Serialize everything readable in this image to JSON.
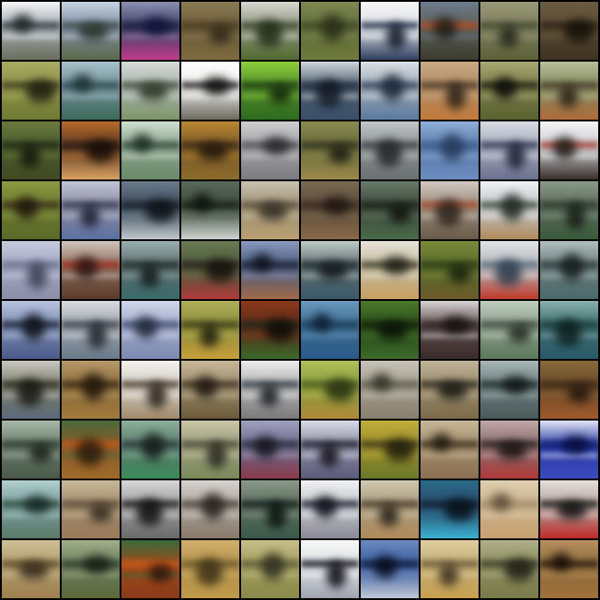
{
  "grid": {
    "rows": 10,
    "columns": 10,
    "tiles": [
      {
        "row": 0,
        "col": 0,
        "bg": "#9fa7ad",
        "top": "#f4f6f7",
        "mid": "#2f3a3e",
        "low": "#6b6f5e",
        "blob": "#1b2022"
      },
      {
        "row": 0,
        "col": 1,
        "bg": "#7d8aa0",
        "top": "#c7d4e3",
        "mid": "#3b4a44",
        "low": "#5d6a4a",
        "blob": "#263026"
      },
      {
        "row": 0,
        "col": 2,
        "bg": "#3a3f63",
        "top": "#8d8fb2",
        "mid": "#1a1c3a",
        "low": "#c23b8a",
        "blob": "#10123a"
      },
      {
        "row": 0,
        "col": 3,
        "bg": "#6b5a38",
        "top": "#8a7b55",
        "mid": "#4a3c22",
        "low": "#7d6a3f",
        "blob": "#2d2516"
      },
      {
        "row": 0,
        "col": 4,
        "bg": "#8c8f7a",
        "top": "#d8dad3",
        "mid": "#3c4a2c",
        "low": "#4f6b2f",
        "blob": "#1c2a12"
      },
      {
        "row": 0,
        "col": 5,
        "bg": "#5f6b3a",
        "top": "#7f8a52",
        "mid": "#3d4a25",
        "low": "#6d7a3a",
        "blob": "#2a2f16"
      },
      {
        "row": 0,
        "col": 6,
        "bg": "#d9dde2",
        "top": "#f7f7f7",
        "mid": "#1c2a45",
        "low": "#2f3f5f",
        "blob": "#0d1526"
      },
      {
        "row": 0,
        "col": 7,
        "bg": "#5c5f58",
        "top": "#6d7b8c",
        "mid": "#b44a1f",
        "low": "#3c3b2f",
        "blob": "#1f1c15"
      },
      {
        "row": 0,
        "col": 8,
        "bg": "#7d7c5d",
        "top": "#9a9a78",
        "mid": "#3f4a2c",
        "low": "#5c6238",
        "blob": "#22261a"
      },
      {
        "row": 0,
        "col": 9,
        "bg": "#5a4a30",
        "top": "#6a5c42",
        "mid": "#2a2118",
        "low": "#3d3222",
        "blob": "#120e08"
      },
      {
        "row": 1,
        "col": 0,
        "bg": "#8d9146",
        "top": "#a8ab63",
        "mid": "#3b3a1f",
        "low": "#6e7a33",
        "blob": "#1c1a0f"
      },
      {
        "row": 1,
        "col": 1,
        "bg": "#6f8b93",
        "top": "#a7c4cc",
        "mid": "#2a4a4f",
        "low": "#3c6a5a",
        "blob": "#1a2f2f"
      },
      {
        "row": 1,
        "col": 2,
        "bg": "#a6b0aa",
        "top": "#d6dcd8",
        "mid": "#3f4f3a",
        "low": "#7d9668",
        "blob": "#2a3322"
      },
      {
        "row": 1,
        "col": 3,
        "bg": "#e7e8e6",
        "top": "#ffffff",
        "mid": "#1a1a1a",
        "low": "#6d6a5d",
        "blob": "#0c0c0c"
      },
      {
        "row": 1,
        "col": 4,
        "bg": "#4f8a2a",
        "top": "#8dcf3a",
        "mid": "#1c3a12",
        "low": "#2f6b1f",
        "blob": "#0f2008"
      },
      {
        "row": 1,
        "col": 5,
        "bg": "#4a5a6a",
        "top": "#cfd7de",
        "mid": "#1f2a3a",
        "low": "#3a4f6a",
        "blob": "#0f1520"
      },
      {
        "row": 1,
        "col": 6,
        "bg": "#9aa5b0",
        "top": "#dbe2e8",
        "mid": "#2f3f5c",
        "low": "#5a7aa0",
        "blob": "#1a2538"
      },
      {
        "row": 1,
        "col": 7,
        "bg": "#b08a62",
        "top": "#c9ab86",
        "mid": "#4a3a2a",
        "low": "#c27a3a",
        "blob": "#2a1f15"
      },
      {
        "row": 1,
        "col": 8,
        "bg": "#7a7a4a",
        "top": "#a8a872",
        "mid": "#1c1f12",
        "low": "#5a6230",
        "blob": "#0c0d08"
      },
      {
        "row": 1,
        "col": 9,
        "bg": "#7f8a5f",
        "top": "#b7bf98",
        "mid": "#4a3a2a",
        "low": "#b06a3a",
        "blob": "#2a1f15"
      },
      {
        "row": 2,
        "col": 0,
        "bg": "#4a5a2a",
        "top": "#6b7a3f",
        "mid": "#1f2616",
        "low": "#3f4a22",
        "blob": "#10140a"
      },
      {
        "row": 2,
        "col": 1,
        "bg": "#5a3a22",
        "top": "#b86a2a",
        "mid": "#2a1a12",
        "low": "#d9a060",
        "blob": "#140c08"
      },
      {
        "row": 2,
        "col": 2,
        "bg": "#8aa08a",
        "top": "#cfe0d0",
        "mid": "#2f4a3a",
        "low": "#6a8a6a",
        "blob": "#1a2a20"
      },
      {
        "row": 2,
        "col": 3,
        "bg": "#7a5a2a",
        "top": "#b8862f",
        "mid": "#3a2814",
        "low": "#8c6a2a",
        "blob": "#1f150a"
      },
      {
        "row": 2,
        "col": 4,
        "bg": "#a0a0a2",
        "top": "#cfcfd2",
        "mid": "#4a4a52",
        "low": "#7a7a82",
        "blob": "#26262a"
      },
      {
        "row": 2,
        "col": 5,
        "bg": "#6a6a3a",
        "top": "#8a8a52",
        "mid": "#2f3020",
        "low": "#9a8a4a",
        "blob": "#181910"
      },
      {
        "row": 2,
        "col": 6,
        "bg": "#8a8f92",
        "top": "#c2c7ca",
        "mid": "#3a3f42",
        "low": "#6a7072",
        "blob": "#1f2224"
      },
      {
        "row": 2,
        "col": 7,
        "bg": "#5a7aa8",
        "top": "#8fb0da",
        "mid": "#3a5a8a",
        "low": "#6a8cc0",
        "blob": "#253a5a"
      },
      {
        "row": 2,
        "col": 8,
        "bg": "#a2a8b8",
        "top": "#d8dce6",
        "mid": "#2f3552",
        "low": "#6a7090",
        "blob": "#181c2f"
      },
      {
        "row": 2,
        "col": 9,
        "bg": "#c8cbd0",
        "top": "#f4f4f4",
        "mid": "#a03a2a",
        "low": "#3a2f2a",
        "blob": "#1c1612"
      },
      {
        "row": 3,
        "col": 0,
        "bg": "#6b7a2f",
        "top": "#8c9a42",
        "mid": "#3a2a1a",
        "low": "#5a6a2a",
        "blob": "#1f160c"
      },
      {
        "row": 3,
        "col": 1,
        "bg": "#8a8aa0",
        "top": "#c0c6d6",
        "mid": "#2f3550",
        "low": "#5a70a0",
        "blob": "#181c2f"
      },
      {
        "row": 3,
        "col": 2,
        "bg": "#3a4a5a",
        "top": "#6a7a8a",
        "mid": "#1a2028",
        "low": "#c0c6cc",
        "blob": "#0c1014"
      },
      {
        "row": 3,
        "col": 3,
        "bg": "#3a4a3a",
        "top": "#5a6a5a",
        "mid": "#1a221a",
        "low": "#d0d4d0",
        "blob": "#0c100c"
      },
      {
        "row": 3,
        "col": 4,
        "bg": "#a09070",
        "top": "#c8c2b2",
        "mid": "#5a5040",
        "low": "#b8a070",
        "blob": "#2f2a20"
      },
      {
        "row": 3,
        "col": 5,
        "bg": "#5a4a3a",
        "top": "#7a6a52",
        "mid": "#3a2a20",
        "low": "#8a6a4a",
        "blob": "#1f1610"
      },
      {
        "row": 3,
        "col": 6,
        "bg": "#3a4a3a",
        "top": "#6a7a6a",
        "mid": "#1a221a",
        "low": "#4a6a4a",
        "blob": "#0c100c"
      },
      {
        "row": 3,
        "col": 7,
        "bg": "#9a8a7a",
        "top": "#d0c8c0",
        "mid": "#a04a2a",
        "low": "#6a5a4a",
        "blob": "#2a1f18"
      },
      {
        "row": 3,
        "col": 8,
        "bg": "#c0c4c8",
        "top": "#f0f2f4",
        "mid": "#3a4a3a",
        "low": "#b08a5a",
        "blob": "#1f261f"
      },
      {
        "row": 3,
        "col": 9,
        "bg": "#5a6a5a",
        "top": "#8a9a8a",
        "mid": "#2a3a2a",
        "low": "#3a5a3a",
        "blob": "#141c14"
      },
      {
        "row": 4,
        "col": 0,
        "bg": "#a0a4c0",
        "top": "#c8cce0",
        "mid": "#6a6e8a",
        "low": "#8a8ea8",
        "blob": "#3a3e52"
      },
      {
        "row": 4,
        "col": 1,
        "bg": "#8a6a5a",
        "top": "#d0c4bc",
        "mid": "#a02a1a",
        "low": "#5a3a2a",
        "blob": "#2a1410"
      },
      {
        "row": 4,
        "col": 2,
        "bg": "#5a6a6a",
        "top": "#9ab0b0",
        "mid": "#1f2a2a",
        "low": "#3a6a6a",
        "blob": "#0f1616"
      },
      {
        "row": 4,
        "col": 3,
        "bg": "#4a5a3a",
        "top": "#6a7a52",
        "mid": "#2a1f1a",
        "low": "#b03a3a",
        "blob": "#150f0c"
      },
      {
        "row": 4,
        "col": 4,
        "bg": "#4a5a7a",
        "top": "#8a9ac0",
        "mid": "#1a2030",
        "low": "#a06a4a",
        "blob": "#0c1018"
      },
      {
        "row": 4,
        "col": 5,
        "bg": "#5a6a6a",
        "top": "#c0ccc8",
        "mid": "#1f2a2f",
        "low": "#3a5a6a",
        "blob": "#0f161a"
      },
      {
        "row": 4,
        "col": 6,
        "bg": "#c0b89a",
        "top": "#e8e4d8",
        "mid": "#3a3a2a",
        "low": "#c8a060",
        "blob": "#1f1f16"
      },
      {
        "row": 4,
        "col": 7,
        "bg": "#5a6a2a",
        "top": "#7a8a3a",
        "mid": "#2a3a16",
        "low": "#6a5a2a",
        "blob": "#141c0a"
      },
      {
        "row": 4,
        "col": 8,
        "bg": "#b0b4b8",
        "top": "#e0e4e8",
        "mid": "#5a6a7a",
        "low": "#c03a2a",
        "blob": "#2a3a4a"
      },
      {
        "row": 4,
        "col": 9,
        "bg": "#6a7a7a",
        "top": "#b0c0c0",
        "mid": "#2a3a3a",
        "low": "#4a6a6a",
        "blob": "#141c1c"
      },
      {
        "row": 5,
        "col": 0,
        "bg": "#7a8ab0",
        "top": "#b8c4e0",
        "mid": "#1a2030",
        "low": "#4a5a8a",
        "blob": "#0c1018"
      },
      {
        "row": 5,
        "col": 1,
        "bg": "#9aa0a8",
        "top": "#d8dce0",
        "mid": "#3a3f48",
        "low": "#6a7a8a",
        "blob": "#1f2228"
      },
      {
        "row": 5,
        "col": 2,
        "bg": "#a0a8c8",
        "top": "#d0d8ec",
        "mid": "#3a4a6a",
        "low": "#7a8ab0",
        "blob": "#1f2638"
      },
      {
        "row": 5,
        "col": 3,
        "bg": "#8a8a3a",
        "top": "#b0b05a",
        "mid": "#3a3a1a",
        "low": "#c8a03a",
        "blob": "#1c1c0c"
      },
      {
        "row": 5,
        "col": 4,
        "bg": "#5a2a1a",
        "top": "#8a3a1a",
        "mid": "#1a2a1a",
        "low": "#3a6a2a",
        "blob": "#0c0c08"
      },
      {
        "row": 5,
        "col": 5,
        "bg": "#3a6a8a",
        "top": "#6a9ac0",
        "mid": "#1a3a5a",
        "low": "#2a5a8a",
        "blob": "#0c1c2f"
      },
      {
        "row": 5,
        "col": 6,
        "bg": "#2a4a1a",
        "top": "#4a7a2a",
        "mid": "#0f1f0a",
        "low": "#3a6a2a",
        "blob": "#070f05"
      },
      {
        "row": 5,
        "col": 7,
        "bg": "#5a4a4a",
        "top": "#d8d4d4",
        "mid": "#2a1f1f",
        "low": "#3a2a2a",
        "blob": "#140f0f"
      },
      {
        "row": 5,
        "col": 8,
        "bg": "#8a9a8a",
        "top": "#c0d0c0",
        "mid": "#3a4a3a",
        "low": "#5a7a5a",
        "blob": "#1c261c"
      },
      {
        "row": 5,
        "col": 9,
        "bg": "#3a6a6a",
        "top": "#8ab0b0",
        "mid": "#1a3a3a",
        "low": "#2a5a6a",
        "blob": "#0c1c1c"
      },
      {
        "row": 6,
        "col": 0,
        "bg": "#7a7a6a",
        "top": "#c8c8c0",
        "mid": "#2a2a22",
        "low": "#5a6a7a",
        "blob": "#14140f"
      },
      {
        "row": 6,
        "col": 1,
        "bg": "#8a6a3a",
        "top": "#b89a6a",
        "mid": "#3a2a16",
        "low": "#a07a3a",
        "blob": "#1f160a"
      },
      {
        "row": 6,
        "col": 2,
        "bg": "#d0cac0",
        "top": "#f4f2ee",
        "mid": "#4a3a2a",
        "low": "#a08a6a",
        "blob": "#261f16"
      },
      {
        "row": 6,
        "col": 3,
        "bg": "#9a8a6a",
        "top": "#c8b89a",
        "mid": "#3a2f1f",
        "low": "#6a5a3a",
        "blob": "#1f1810"
      },
      {
        "row": 6,
        "col": 4,
        "bg": "#b0b0b0",
        "top": "#ececec",
        "mid": "#2f3a42",
        "low": "#7a7a7a",
        "blob": "#161c20"
      },
      {
        "row": 6,
        "col": 5,
        "bg": "#8a9a3a",
        "top": "#b0c05a",
        "mid": "#4a5a1f",
        "low": "#b08a3a",
        "blob": "#262f10"
      },
      {
        "row": 6,
        "col": 6,
        "bg": "#a09a8a",
        "top": "#c8c4b8",
        "mid": "#5a5a4a",
        "low": "#8a8070",
        "blob": "#2f2f26"
      },
      {
        "row": 6,
        "col": 7,
        "bg": "#9a8a6a",
        "top": "#c0b498",
        "mid": "#2a2a22",
        "low": "#7a6a4a",
        "blob": "#141410"
      },
      {
        "row": 6,
        "col": 8,
        "bg": "#6a7a7a",
        "top": "#a8b8b8",
        "mid": "#1f2a2a",
        "low": "#4a5a5a",
        "blob": "#0f1616"
      },
      {
        "row": 6,
        "col": 9,
        "bg": "#6a4a2a",
        "top": "#8a6a3a",
        "mid": "#3a2616",
        "low": "#a05a2a",
        "blob": "#1f140a"
      },
      {
        "row": 7,
        "col": 0,
        "bg": "#6a7a6a",
        "top": "#a8b8a8",
        "mid": "#2a3a2a",
        "low": "#4a5a4a",
        "blob": "#141c14"
      },
      {
        "row": 7,
        "col": 1,
        "bg": "#8a5a2a",
        "top": "#4a6a3a",
        "mid": "#c05a1a",
        "low": "#a06a2a",
        "blob": "#2a1a0a"
      },
      {
        "row": 7,
        "col": 2,
        "bg": "#5a7a6a",
        "top": "#8ab09a",
        "mid": "#2a3a3a",
        "low": "#3a8a5a",
        "blob": "#141c1c"
      },
      {
        "row": 7,
        "col": 3,
        "bg": "#9a9a7a",
        "top": "#c8c8a8",
        "mid": "#4a4a3a",
        "low": "#7a8a5a",
        "blob": "#26261c"
      },
      {
        "row": 7,
        "col": 4,
        "bg": "#6a6a8a",
        "top": "#a0a0c0",
        "mid": "#2a2a3a",
        "low": "#8a3a4a",
        "blob": "#14141c"
      },
      {
        "row": 7,
        "col": 5,
        "bg": "#8a8aa0",
        "top": "#d8dce8",
        "mid": "#1a1a2a",
        "low": "#5a5a7a",
        "blob": "#0c0c14"
      },
      {
        "row": 7,
        "col": 6,
        "bg": "#9a8a2a",
        "top": "#c0b03a",
        "mid": "#3a3a1a",
        "low": "#6a7a2a",
        "blob": "#1c1c0c"
      },
      {
        "row": 7,
        "col": 7,
        "bg": "#a08a6a",
        "top": "#c8b898",
        "mid": "#3a2f1f",
        "low": "#8a7050",
        "blob": "#1f1810"
      },
      {
        "row": 7,
        "col": 8,
        "bg": "#8a6a6a",
        "top": "#c0a8a8",
        "mid": "#2a1f1f",
        "low": "#b03a3a",
        "blob": "#140f0f"
      },
      {
        "row": 7,
        "col": 9,
        "bg": "#2a3aa0",
        "top": "#e0e4f8",
        "mid": "#0f1a6a",
        "low": "#3a4ac0",
        "blob": "#070c38"
      },
      {
        "row": 8,
        "col": 0,
        "bg": "#7a9a9a",
        "top": "#b0d0d0",
        "mid": "#2a4a3a",
        "low": "#5a7a6a",
        "blob": "#142620"
      },
      {
        "row": 8,
        "col": 1,
        "bg": "#a08a6a",
        "top": "#c8b89a",
        "mid": "#5a4a3a",
        "low": "#9a7a5a",
        "blob": "#2f261c"
      },
      {
        "row": 8,
        "col": 2,
        "bg": "#9a9a9a",
        "top": "#d8d8d8",
        "mid": "#1a1a1a",
        "low": "#6a6a6a",
        "blob": "#0c0c0c"
      },
      {
        "row": 8,
        "col": 3,
        "bg": "#a8a098",
        "top": "#d8d4d0",
        "mid": "#4a4038",
        "low": "#8a7a6a",
        "blob": "#26201c"
      },
      {
        "row": 8,
        "col": 4,
        "bg": "#5a6a5a",
        "top": "#8a9a8a",
        "mid": "#0f1f1a",
        "low": "#3a5a4a",
        "blob": "#070f0c"
      },
      {
        "row": 8,
        "col": 5,
        "bg": "#c0c4c8",
        "top": "#f0f2f4",
        "mid": "#1a2030",
        "low": "#8a8a98",
        "blob": "#0c1018"
      },
      {
        "row": 8,
        "col": 6,
        "bg": "#a89a7a",
        "top": "#d0c8b0",
        "mid": "#4a3a2a",
        "low": "#b08a5a",
        "blob": "#261f16"
      },
      {
        "row": 8,
        "col": 7,
        "bg": "#2a4a6a",
        "top": "#2a6a8a",
        "mid": "#0f1f2f",
        "low": "#3ab0d0",
        "blob": "#070f18"
      },
      {
        "row": 8,
        "col": 8,
        "bg": "#c8b08a",
        "top": "#e0d0b0",
        "mid": "#a08a6a",
        "low": "#c8a070",
        "blob": "#5a4a38"
      },
      {
        "row": 8,
        "col": 9,
        "bg": "#b0a098",
        "top": "#e8e0dc",
        "mid": "#1a1a1a",
        "low": "#c02a2a",
        "blob": "#0c0c0c"
      },
      {
        "row": 9,
        "col": 0,
        "bg": "#b09a6a",
        "top": "#d0c098",
        "mid": "#5a4a2a",
        "low": "#a08050",
        "blob": "#2f2616"
      },
      {
        "row": 9,
        "col": 1,
        "bg": "#6a7a5a",
        "top": "#a0b08a",
        "mid": "#2a3a2a",
        "low": "#5a6a3a",
        "blob": "#141c14"
      },
      {
        "row": 9,
        "col": 2,
        "bg": "#a04a1a",
        "top": "#3a6a3a",
        "mid": "#d05a1a",
        "low": "#8a3a1a",
        "blob": "#2a140a"
      },
      {
        "row": 9,
        "col": 3,
        "bg": "#b0904a",
        "top": "#d0b06a",
        "mid": "#6a5a2a",
        "low": "#c09a4a",
        "blob": "#3a2f16"
      },
      {
        "row": 9,
        "col": 4,
        "bg": "#a09a5a",
        "top": "#c8c08a",
        "mid": "#5a5a3a",
        "low": "#8a8a4a",
        "blob": "#2f2f1f"
      },
      {
        "row": 9,
        "col": 5,
        "bg": "#d8dce0",
        "top": "#f8f8f8",
        "mid": "#0f0f1a",
        "low": "#a0a4b0",
        "blob": "#070710"
      },
      {
        "row": 9,
        "col": 6,
        "bg": "#3a5a9a",
        "top": "#6a8ac0",
        "mid": "#0f1a3a",
        "low": "#c0c8d8",
        "blob": "#070c1c"
      },
      {
        "row": 9,
        "col": 7,
        "bg": "#c0a870",
        "top": "#e0d0a0",
        "mid": "#6a5a3a",
        "low": "#c8a050",
        "blob": "#3a2f1f"
      },
      {
        "row": 9,
        "col": 8,
        "bg": "#8a8a5a",
        "top": "#b0b08a",
        "mid": "#3a3a2a",
        "low": "#7a7a4a",
        "blob": "#1c1c14"
      },
      {
        "row": 9,
        "col": 9,
        "bg": "#8a6a3a",
        "top": "#b89060",
        "mid": "#2a1a0f",
        "low": "#a0703a",
        "blob": "#140c07"
      }
    ]
  }
}
